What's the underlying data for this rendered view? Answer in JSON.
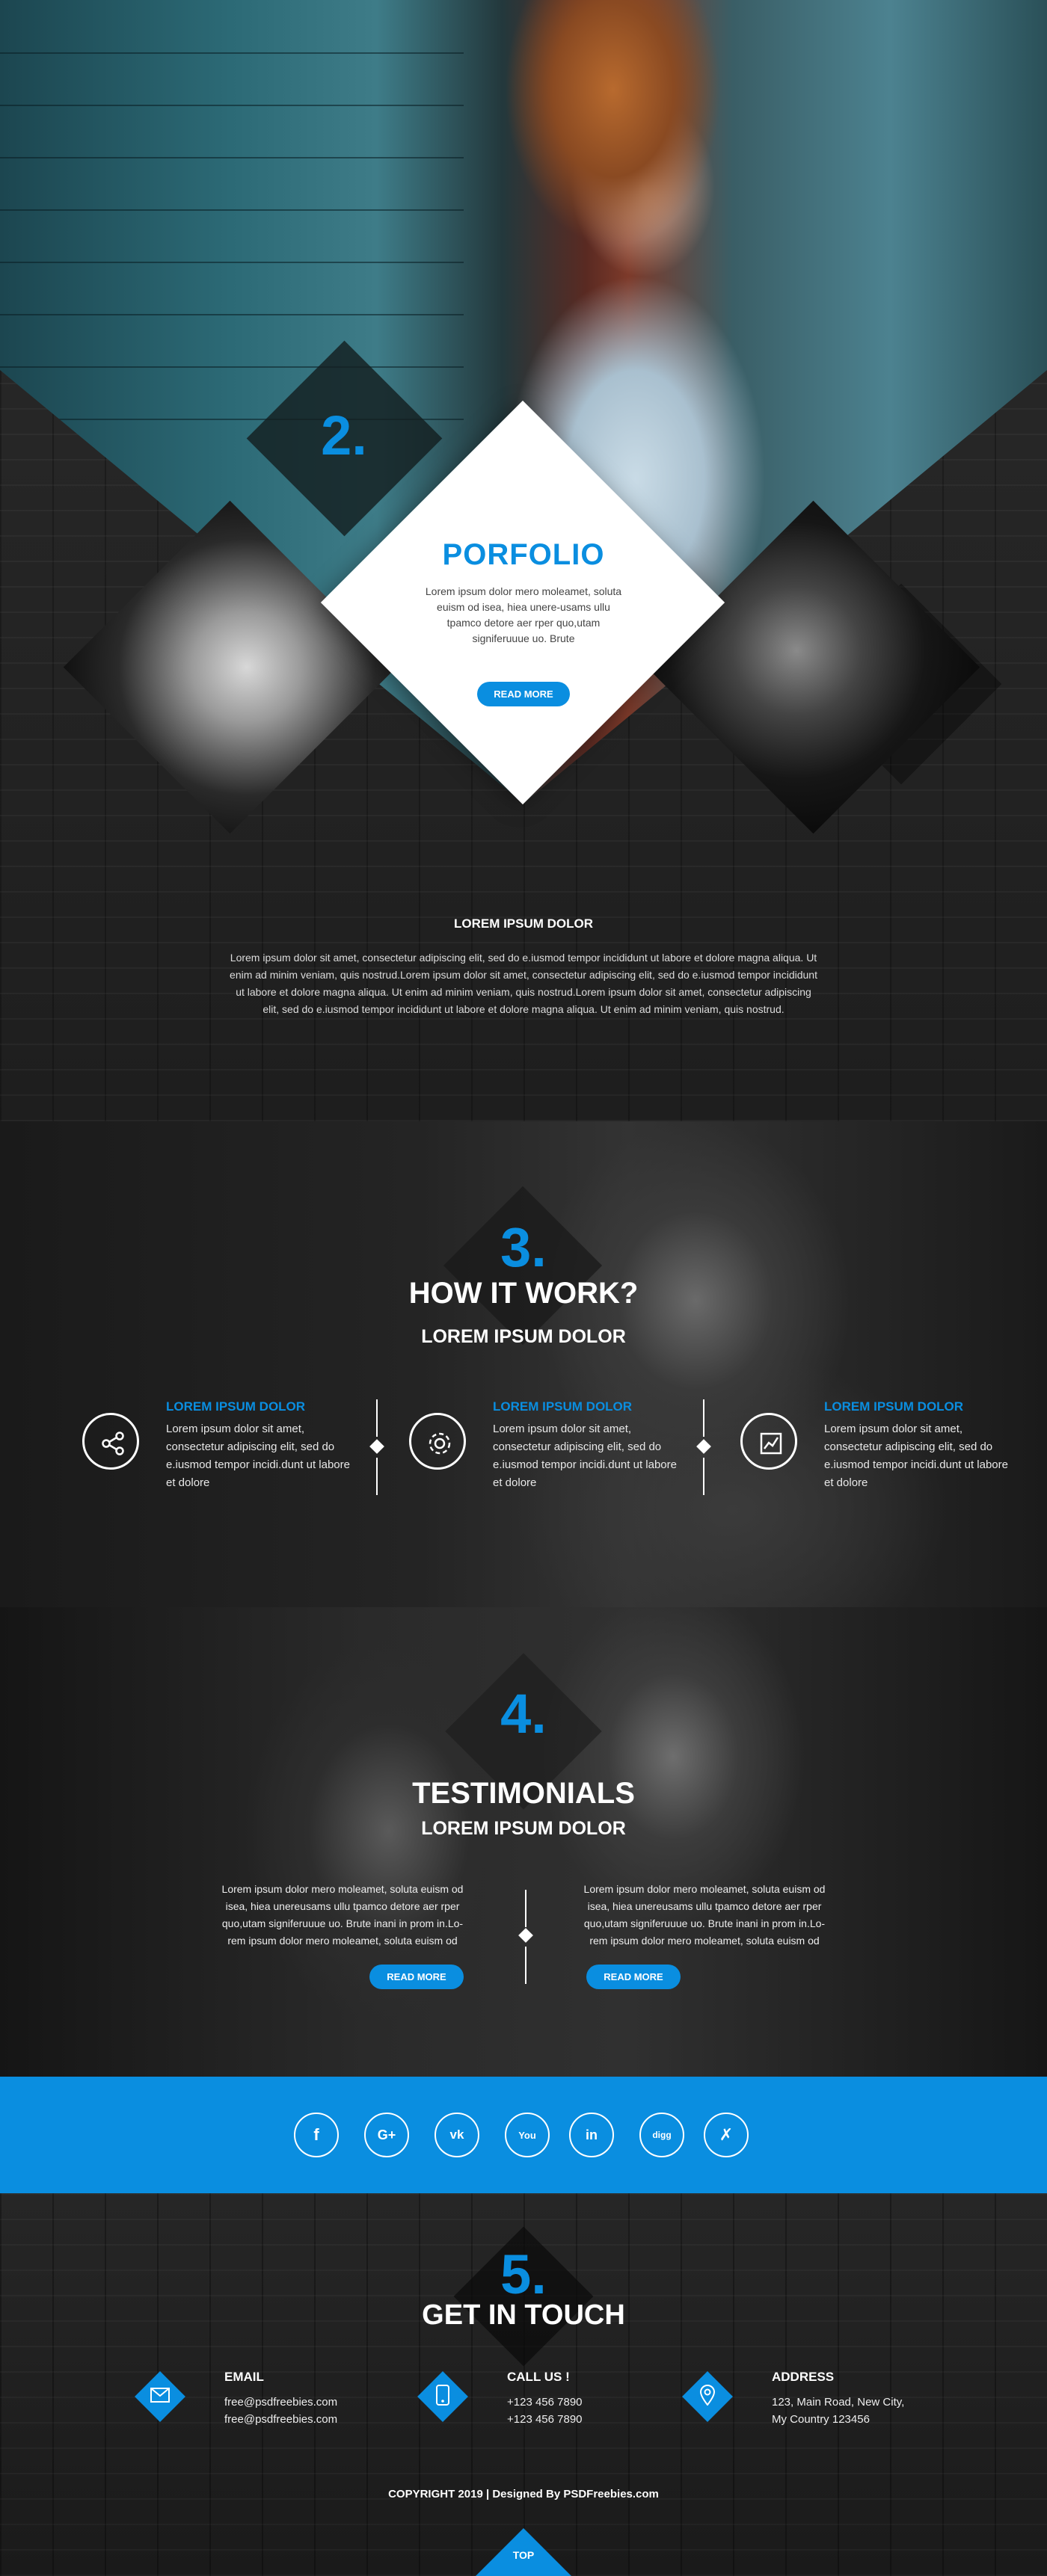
{
  "portfolio": {
    "number": "2.",
    "title": "PORFOLIO",
    "text": "Lorem ipsum dolor  mero moleamet, soluta euism od isea, hiea unere-usams ullu tpamco detore  aer rper quo,utam signiferuuue uo. Brute",
    "button": "READ MORE",
    "about_title": "LOREM IPSUM DOLOR",
    "about_text": "Lorem ipsum dolor sit amet, consectetur adipiscing elit, sed do e.iusmod tempor incididunt ut labore et dolore magna aliqua. Ut enim ad minim veniam, quis nostrud.Lorem ipsum dolor sit amet, consectetur adipiscing elit, sed do e.iusmod tempor incididunt ut labore et dolore magna aliqua. Ut enim ad minim veniam, quis nostrud.Lorem ipsum dolor sit amet, consectetur adipiscing elit, sed do e.iusmod tempor incididunt ut labore et dolore magna aliqua. Ut enim ad minim veniam, quis nostrud."
  },
  "how": {
    "number": "3.",
    "title": "HOW IT WORK?",
    "subtitle": "LOREM IPSUM DOLOR",
    "steps": [
      {
        "icon": "share-icon",
        "title": "LOREM IPSUM DOLOR",
        "text": "Lorem ipsum dolor sit amet, consectetur adipiscing elit, sed do e.iusmod tempor incidi.dunt ut labore et dolore"
      },
      {
        "icon": "gear-icon",
        "title": "LOREM IPSUM DOLOR",
        "text": "Lorem ipsum dolor sit amet, consectetur adipiscing elit, sed do e.iusmod tempor incidi.dunt ut labore et dolore"
      },
      {
        "icon": "chart-icon",
        "title": "LOREM IPSUM DOLOR",
        "text": "Lorem ipsum dolor sit amet, consectetur adipiscing elit, sed do e.iusmod tempor incidi.dunt ut labore et dolore"
      }
    ]
  },
  "testimonials": {
    "number": "4.",
    "title": "TESTIMONIALS",
    "subtitle": "LOREM IPSUM DOLOR",
    "quotes": [
      {
        "text": "Lorem ipsum dolor  mero moleamet, soluta euism od isea, hiea unereusams ullu tpamco detore  aer rper quo,utam signiferuuue uo. Brute inani in prom in.Lo-rem ipsum dolor  mero moleamet, soluta euism od",
        "button": "READ MORE"
      },
      {
        "text": "Lorem ipsum dolor  mero moleamet, soluta euism od isea, hiea unereusams ullu tpamco detore  aer rper quo,utam signiferuuue uo. Brute inani in prom in.Lo-rem ipsum dolor  mero moleamet, soluta euism od",
        "button": "READ MORE"
      }
    ]
  },
  "social": [
    {
      "icon": "facebook-icon",
      "glyph": "f"
    },
    {
      "icon": "google-plus-icon",
      "glyph": "G+"
    },
    {
      "icon": "vk-icon",
      "glyph": "vk"
    },
    {
      "icon": "youtube-icon",
      "glyph": "You"
    },
    {
      "icon": "linkedin-icon",
      "glyph": "in"
    },
    {
      "icon": "digg-icon",
      "glyph": "digg"
    },
    {
      "icon": "xing-icon",
      "glyph": "✗"
    }
  ],
  "contact": {
    "number": "5.",
    "title": "GET IN TOUCH",
    "items": [
      {
        "icon": "mail-icon",
        "label": "EMAIL",
        "lines": [
          "free@psdfreebies.com",
          "free@psdfreebies.com"
        ]
      },
      {
        "icon": "phone-icon",
        "label": "CALL US !",
        "lines": [
          "+123 456 7890",
          "+123 456 7890"
        ]
      },
      {
        "icon": "map-pin-icon",
        "label": "ADDRESS",
        "lines": [
          "123, Main Road, New City,",
          "My Country 123456"
        ]
      }
    ],
    "copyright": "COPYRIGHT 2019  |  Designed By PSDFreebies.com",
    "top_label": "TOP"
  },
  "colors": {
    "accent": "#0a8ee0",
    "dark": "#1e1e1e",
    "white": "#ffffff"
  }
}
